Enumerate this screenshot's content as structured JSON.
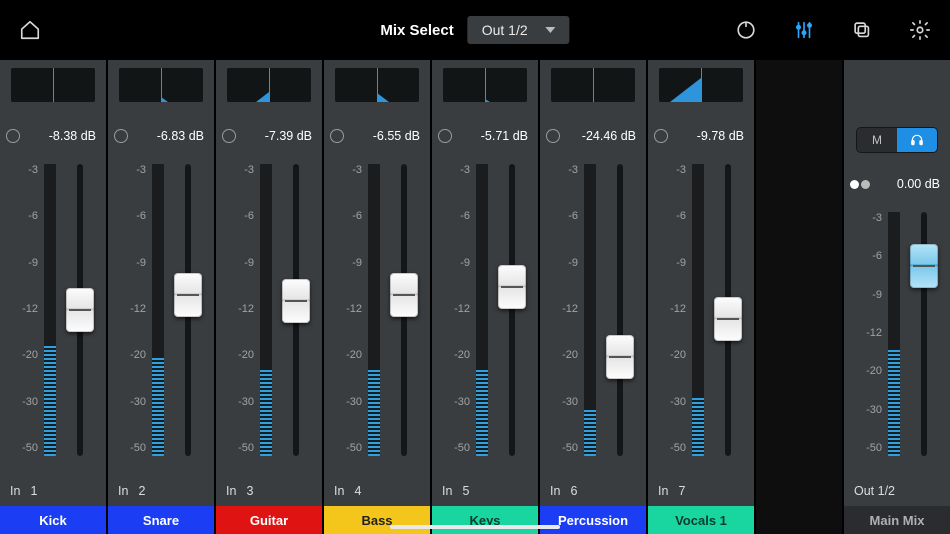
{
  "header": {
    "mix_select_label": "Mix Select",
    "output_selected": "Out  1/2"
  },
  "scale_labels": [
    "-3",
    "-6",
    "-9",
    "-12",
    "-20",
    "-30",
    "-50"
  ],
  "channels": [
    {
      "in_label": "In",
      "in_num": "1",
      "db": "-8.38 dB",
      "name": "Kick",
      "plate_color": "#1b3ef5",
      "plate_text": "#ffffff",
      "fader_pos": 0.5,
      "meter": 0.38,
      "pan": 0
    },
    {
      "in_label": "In",
      "in_num": "2",
      "db": "-6.83 dB",
      "name": "Snare",
      "plate_color": "#1b3ef5",
      "plate_text": "#ffffff",
      "fader_pos": 0.45,
      "meter": 0.34,
      "pan": 0.18
    },
    {
      "in_label": "In",
      "in_num": "3",
      "db": "-7.39 dB",
      "name": "Guitar",
      "plate_color": "#e01313",
      "plate_text": "#ffffff",
      "fader_pos": 0.47,
      "meter": 0.3,
      "pan": -0.32
    },
    {
      "in_label": "In",
      "in_num": "4",
      "db": "-6.55 dB",
      "name": "Bass",
      "plate_color": "#f4c61c",
      "plate_text": "#222222",
      "fader_pos": 0.45,
      "meter": 0.3,
      "pan": 0.3
    },
    {
      "in_label": "In",
      "in_num": "5",
      "db": "-5.71 dB",
      "name": "Keys",
      "plate_color": "#19d6a1",
      "plate_text": "#0c3c2e",
      "fader_pos": 0.42,
      "meter": 0.3,
      "pan": 0.12
    },
    {
      "in_label": "In",
      "in_num": "6",
      "db": "-24.46 dB",
      "name": "Percussion",
      "plate_color": "#1b3ef5",
      "plate_text": "#ffffff",
      "fader_pos": 0.66,
      "meter": 0.16,
      "pan": 0
    },
    {
      "in_label": "In",
      "in_num": "7",
      "db": "-9.78 dB",
      "name": "Vocals 1",
      "plate_color": "#19d6a1",
      "plate_text": "#0c3c2e",
      "fader_pos": 0.53,
      "meter": 0.2,
      "pan": -0.75
    }
  ],
  "output": {
    "db": "0.00 dB",
    "out_label": "Out  1/2",
    "name": "Main Mix",
    "fader_pos": 0.22,
    "meter": 0.44,
    "mute_label": "M",
    "linked": true
  }
}
